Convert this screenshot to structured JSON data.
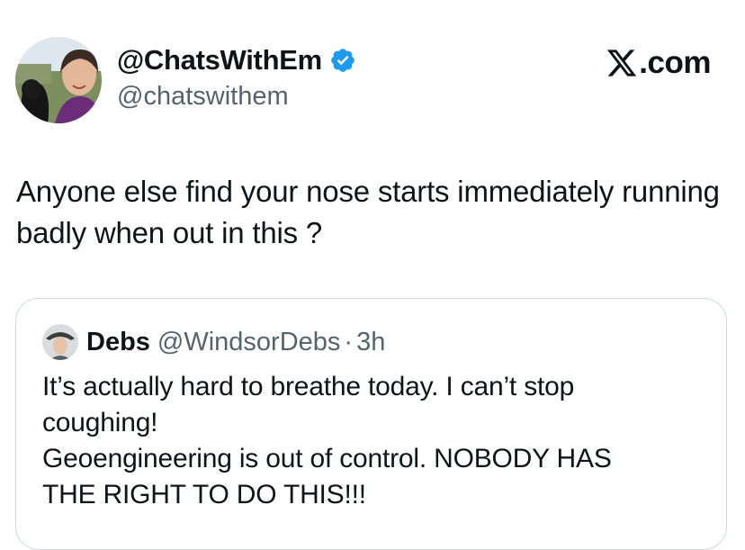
{
  "author": {
    "display_name": "@ChatsWithEm",
    "handle": "@chatswithem",
    "verified": true
  },
  "brand": {
    "label": ".com",
    "icon": "x-logo-icon"
  },
  "tweet": {
    "text": "Anyone else find your nose starts immediately running badly when out in this ?"
  },
  "quoted_tweet": {
    "display_name": "Debs",
    "handle": "@WindsorDebs",
    "separator": "·",
    "time": "3h",
    "lines": [
      "It’s actually hard to breathe today. I can’t stop",
      "coughing!",
      "Geoengineering is out of control. NOBODY HAS",
      "THE RIGHT TO DO THIS!!!"
    ]
  },
  "colors": {
    "text_primary": "#0f1419",
    "text_secondary": "#536471",
    "verified_blue": "#1d9bf0",
    "card_border": "#cfd9de"
  }
}
